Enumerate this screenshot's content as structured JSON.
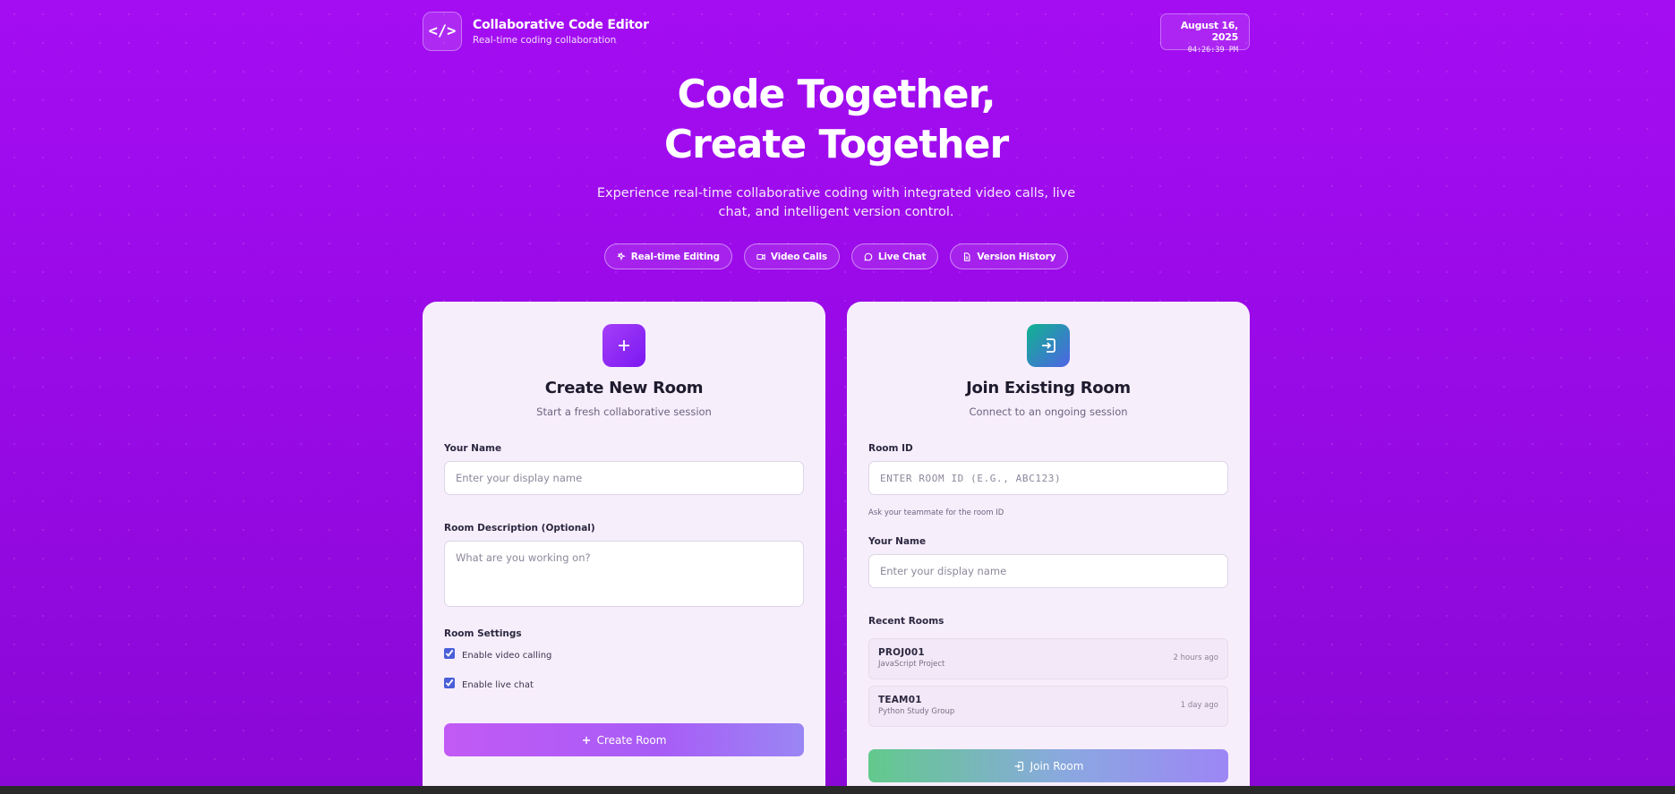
{
  "header": {
    "brand_icon": "</>",
    "title": "Collaborative Code Editor",
    "subtitle": "Real-time coding collaboration",
    "date": "August 16, 2025",
    "time": "04:26:39 PM"
  },
  "hero": {
    "title_line1": "Code Together,",
    "title_line2": "Create Together",
    "subtitle": "Experience real-time collaborative coding with integrated video calls, live chat, and intelligent version control."
  },
  "features": [
    {
      "label": "Real-time Editing",
      "icon": "sparkle-icon"
    },
    {
      "label": "Video Calls",
      "icon": "video-icon"
    },
    {
      "label": "Live Chat",
      "icon": "chat-icon"
    },
    {
      "label": "Version History",
      "icon": "document-icon"
    }
  ],
  "create": {
    "title": "Create New Room",
    "subtitle": "Start a fresh collaborative session",
    "name_label": "Your Name",
    "name_placeholder": "Enter your display name",
    "desc_label": "Room Description (Optional)",
    "desc_placeholder": "What are you working on?",
    "settings_label": "Room Settings",
    "video_label": "Enable video calling",
    "chat_label": "Enable live chat",
    "button": "Create Room"
  },
  "join": {
    "title": "Join Existing Room",
    "subtitle": "Connect to an ongoing session",
    "room_label": "Room ID",
    "room_placeholder": "ENTER ROOM ID (E.G., ABC123)",
    "room_hint": "Ask your teammate for the room ID",
    "name_label": "Your Name",
    "name_placeholder": "Enter your display name",
    "recent_label": "Recent Rooms",
    "recent": [
      {
        "id": "PROJ001",
        "desc": "JavaScript Project",
        "time": "2 hours ago"
      },
      {
        "id": "TEAM01",
        "desc": "Python Study Group",
        "time": "1 day ago"
      }
    ],
    "button": "Join Room"
  },
  "colors": {
    "background": "#a40df2",
    "card": "#f7eefb",
    "create_icon": "#8a2cf5",
    "join_icon": "#10b390"
  }
}
